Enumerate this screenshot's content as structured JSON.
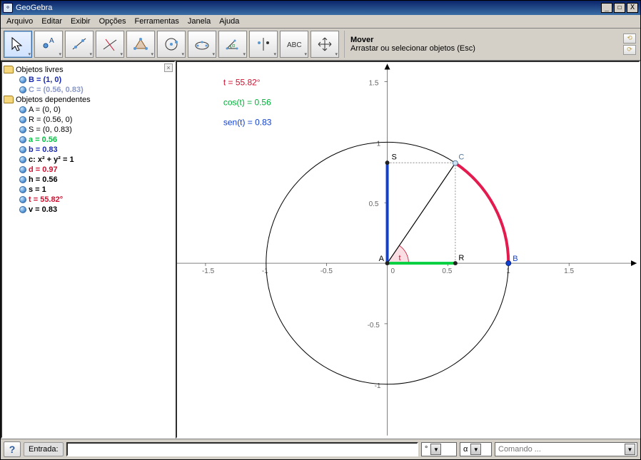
{
  "app": {
    "title": "GeoGebra"
  },
  "titlebuttons": {
    "min": "_",
    "max": "☐",
    "close": "X"
  },
  "menu": {
    "file": "Arquivo",
    "edit": "Editar",
    "view": "Exibir",
    "options": "Opções",
    "tools": "Ferramentas",
    "window": "Janela",
    "help": "Ajuda"
  },
  "tooltip": {
    "title": "Mover",
    "desc": "Arrastar ou selecionar objetos (Esc)"
  },
  "sidebar": {
    "free_label": "Objetos livres",
    "dep_label": "Objetos dependentes",
    "free_items": [
      {
        "text": "B = (1, 0)",
        "color": "#1828B0",
        "weight": "bold"
      },
      {
        "text": "C = (0.56, 0.83)",
        "color": "#8b99c7",
        "weight": "bold"
      }
    ],
    "dep_items": [
      {
        "text": "A = (0, 0)",
        "color": "#000000",
        "weight": "normal"
      },
      {
        "text": "R = (0.56, 0)",
        "color": "#000000",
        "weight": "normal"
      },
      {
        "text": "S = (0, 0.83)",
        "color": "#000000",
        "weight": "normal"
      },
      {
        "text": "a = 0.56",
        "color": "#00c040",
        "weight": "bold"
      },
      {
        "text": "b = 0.83",
        "color": "#1828B0",
        "weight": "bold"
      },
      {
        "text": "c: x² + y² = 1",
        "color": "#000000",
        "weight": "bold"
      },
      {
        "text": "d = 0.97",
        "color": "#d01030",
        "weight": "bold"
      },
      {
        "text": "h = 0.56",
        "color": "#000000",
        "weight": "bold"
      },
      {
        "text": "s = 1",
        "color": "#000000",
        "weight": "bold"
      },
      {
        "text": "t = 55.82°",
        "color": "#d01030",
        "weight": "bold"
      },
      {
        "text": "v = 0.83",
        "color": "#000000",
        "weight": "bold"
      }
    ]
  },
  "canvas": {
    "texts": {
      "t": "t = 55.82°",
      "cos": "cos(t) = 0.56",
      "sen": "sen(t) = 0.83"
    },
    "ticks": {
      "m15": "-1.5",
      "m1": "-1",
      "m05": "-0.5",
      "p05": "0.5",
      "p1": "1",
      "p15": "1.5",
      "zero": "0"
    },
    "labels": {
      "A": "A",
      "B": "B",
      "C": "C",
      "R": "R",
      "S": "S",
      "t": "t"
    }
  },
  "bottombar": {
    "help": "?",
    "input_label": "Entrada:",
    "input_value": "",
    "unit": "°",
    "alpha": "α",
    "command": "Comando ..."
  },
  "chart_data": {
    "type": "diagram",
    "description": "Unit circle x²+y²=1 centered at origin with angle t marked; point C on circle at angle t; R is foot on x-axis; S is foot on y-axis; green segment AR = cos(t); blue segment AS = sin(t); red arc from B to C has length d.",
    "t_deg": 55.82,
    "cos_t": 0.56,
    "sin_t": 0.83,
    "points": {
      "A": [
        0,
        0
      ],
      "B": [
        1,
        0
      ],
      "C": [
        0.56,
        0.83
      ],
      "R": [
        0.56,
        0
      ],
      "S": [
        0,
        0.83
      ]
    },
    "values": {
      "a": 0.56,
      "b": 0.83,
      "d": 0.97,
      "h": 0.56,
      "s": 1,
      "v": 0.83
    },
    "circle": "x²+y²=1",
    "x_range": [
      -1.8,
      1.9
    ],
    "y_range": [
      -1.4,
      1.8
    ]
  }
}
